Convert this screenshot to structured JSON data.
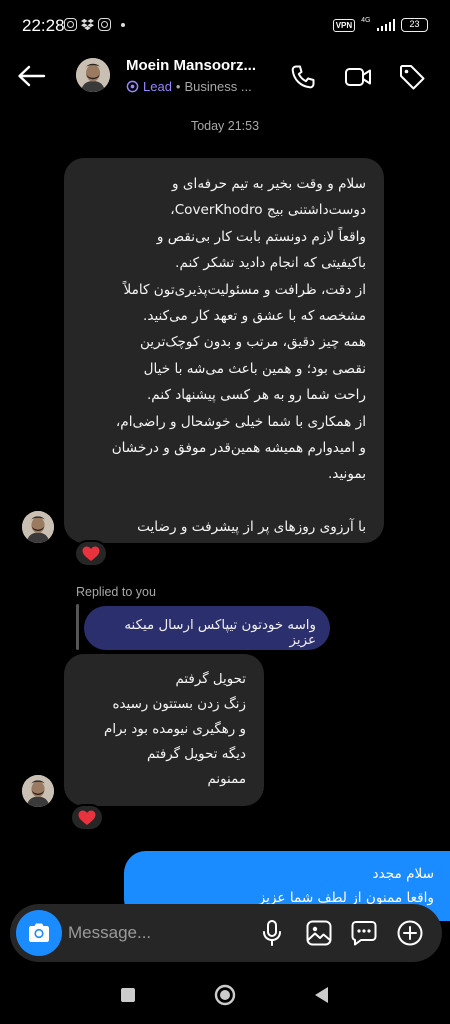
{
  "status_bar": {
    "time": "22:28",
    "vpn": "VPN",
    "network": "4G",
    "battery": "23"
  },
  "header": {
    "name": "Moein Mansoorz...",
    "badge": "Lead",
    "separator": "•",
    "category": "Business ..."
  },
  "chat": {
    "timestamp": "Today 21:53",
    "message1_lines": [
      "سلام و وقت بخیر به تیم حرفه‌ای و",
      "دوست‌داشتنی بیج CoverKhodro،",
      "واقعاً لازم دونستم بابت کار بی‌نقص و",
      "باکیفیتی که انجام دادید تشکر کنم.",
      "از دقت، ظرافت و مسئولیت‌پذیری‌تون کاملاً",
      "مشخصه که با عشق و تعهد کار می‌کنید.",
      "همه چیز دقیق، مرتب و بدون کوچک‌ترین",
      "نقصی بود؛ و همین باعث می‌شه با خیال",
      "راحت شما رو به هر کسی پیشنهاد کنم.",
      "از همکاری با شما خیلی خوشحال و راضی‌ام،",
      "و امیدوارم همیشه همین‌قدر موفق و درخشان",
      "بمونید.",
      "",
      "با آرزوی روزهای پر از پیشرفت و رضایت"
    ],
    "replied_label": "Replied to you",
    "reply_quote": "واسه خودتون تیپاکس ارسال میکنه عزیز",
    "message2_lines": [
      "تحویل گرفتم",
      "زنگ زدن بستتون رسیده",
      "و رهگیری نیومده بود برام",
      "دیگه تحویل گرفتم",
      "ممنونم"
    ],
    "outgoing_lines": [
      "سلام مجدد",
      "واقعا ممنون از لطف شما عزیز"
    ],
    "reaction": "❤️"
  },
  "composer": {
    "placeholder": "Message..."
  },
  "colors": {
    "outgoing_bubble": "#1a8cff",
    "incoming_bubble": "#262626",
    "reply_bubble": "#2b2f6e",
    "lead_badge": "#9a84ff"
  },
  "icons": [
    "back-arrow-icon",
    "phone-icon",
    "video-camera-icon",
    "tag-icon",
    "camera-icon",
    "microphone-icon",
    "gallery-icon",
    "sticker-icon",
    "plus-icon",
    "heart-icon"
  ]
}
